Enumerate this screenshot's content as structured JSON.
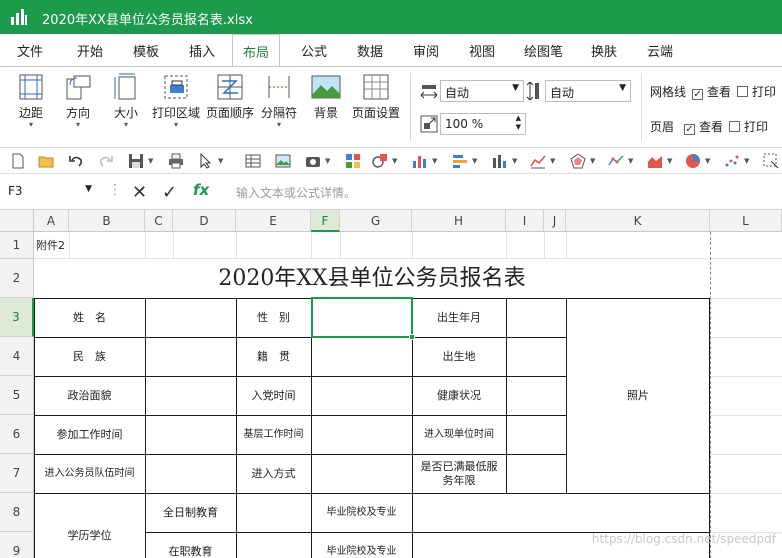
{
  "titlebar": {
    "title": "2020年XX县单位公务员报名表.xlsx",
    "color": "#1e9a4c"
  },
  "menu": {
    "tabs": [
      "文件",
      "开始",
      "模板",
      "插入",
      "布局",
      "公式",
      "数据",
      "审阅",
      "视图",
      "绘图笔",
      "换肤",
      "云端"
    ],
    "active": "布局"
  },
  "ribbon": {
    "margins": "边距",
    "orientation": "方向",
    "size": "大小",
    "print_area": "打印区域",
    "page_order": "页面顺序",
    "separator": "分隔符",
    "background": "背景",
    "page_setup": "页面设置",
    "width_value": "自动",
    "height_value": "自动",
    "zoom_value": "100 %",
    "gridlines": "网格线",
    "header": "页眉",
    "view": "查看",
    "print": "打印",
    "gridlines_view_checked": true,
    "gridlines_print_checked": false,
    "header_view_checked": true,
    "header_print_checked": false
  },
  "formula": {
    "name_box": "F3",
    "placeholder": "输入文本或公式详情。",
    "fx": "fx"
  },
  "columns": [
    "A",
    "B",
    "C",
    "D",
    "E",
    "F",
    "G",
    "H",
    "I",
    "J",
    "K",
    "L"
  ],
  "active_column": "F",
  "rows": [
    "1",
    "2",
    "3",
    "4",
    "5",
    "6",
    "7",
    "8",
    "9"
  ],
  "active_row": "3",
  "sheet": {
    "a1": "附件2",
    "title": "2020年XX县单位公务员报名表",
    "name": "姓　名",
    "gender": "性　别",
    "birth_date": "出生年月",
    "ethnicity": "民　族",
    "native_place": "籍　贯",
    "birthplace": "出生地",
    "political_status": "政治面貌",
    "party_date": "入党时间",
    "health": "健康状况",
    "photo": "照片",
    "work_start": "参加工作时间",
    "grassroots_work": "基层工作时间",
    "current_unit_time": "进入现单位时间",
    "civil_service_entry": "进入公务员队伍时间",
    "entry_method": "进入方式",
    "service_years": "是否已满最低服务年限",
    "education_degree": "学历学位",
    "fulltime_edu": "全日制教育",
    "school_major": "毕业院校及专业",
    "inservice_edu": "在职教育",
    "school_major2": "毕业院校及专业"
  },
  "watermark": "https://blog.csdn.net/speedpdf"
}
